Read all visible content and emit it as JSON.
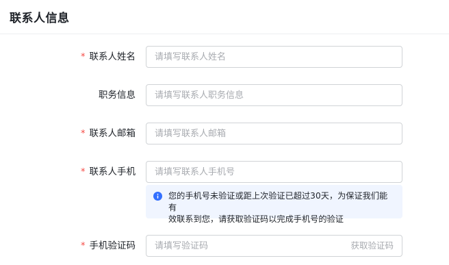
{
  "section": {
    "title": "联系人信息"
  },
  "form": {
    "contact_name": {
      "label": "联系人姓名",
      "required": true,
      "placeholder": "请填写联系人姓名",
      "value": ""
    },
    "position": {
      "label": "职务信息",
      "required": false,
      "placeholder": "请填写联系人职务信息",
      "value": ""
    },
    "email": {
      "label": "联系人邮箱",
      "required": true,
      "placeholder": "请填写联系人邮箱",
      "value": ""
    },
    "phone": {
      "label": "联系人手机",
      "required": true,
      "placeholder": "请填写联系人手机号",
      "value": ""
    },
    "phone_notice": {
      "icon": "info-icon",
      "line1": "您的手机号未验证或距上次验证已超过30天，为保证我们能有",
      "line2": "效联系到您，请获取验证码以完成手机号的验证"
    },
    "verify_code": {
      "label": "手机验证码",
      "required": true,
      "placeholder": "请填写验证码",
      "value": "",
      "button_label": "获取验证码"
    },
    "required_mark": "*"
  },
  "colors": {
    "required": "#f54a45",
    "notice_bg": "#f0f5ff",
    "info_icon": "#3370ff",
    "placeholder": "#a8abb0",
    "border": "#d0d3d6"
  }
}
